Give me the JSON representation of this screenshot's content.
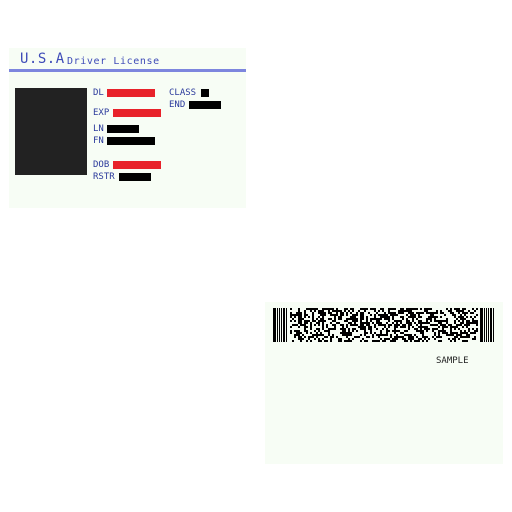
{
  "front": {
    "country": "U.S.A",
    "title": "Driver License",
    "fields": {
      "dl": "DL",
      "exp": "EXP",
      "ln": "LN",
      "fn": "FN",
      "dob": "DOB",
      "rstr": "RSTR",
      "class": "CLASS",
      "end": "END"
    }
  },
  "back": {
    "sample": "SAMPLE"
  },
  "colors": {
    "card_bg": "#f7fdf5",
    "header_text": "#3e4bb8",
    "header_rule": "#7d86de",
    "redaction_red": "#e8222a",
    "redaction_black": "#000000",
    "photo": "#222222"
  }
}
